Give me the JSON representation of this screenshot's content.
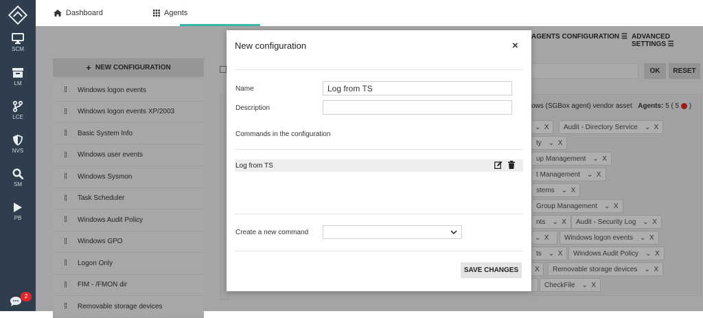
{
  "sidebar": {
    "items": [
      {
        "label": "SCM",
        "icon": "monitor-icon"
      },
      {
        "label": "LM",
        "icon": "archive-icon"
      },
      {
        "label": "LCE",
        "icon": "branch-icon"
      },
      {
        "label": "NVS",
        "icon": "shield-icon"
      },
      {
        "label": "SM",
        "icon": "search-icon"
      },
      {
        "label": "PB",
        "icon": "play-icon"
      }
    ],
    "chat_badge": "2"
  },
  "topbar": {
    "tabs": [
      {
        "label": "Dashboard",
        "icon": "home-icon"
      },
      {
        "label": "Agents",
        "icon": "grid-icon"
      }
    ]
  },
  "subheader": {
    "agents_config": "AGENTS CONFIGURATION",
    "advanced_settings": "ADVANCED SETTINGS"
  },
  "left": {
    "new_config_label": "NEW CONFIGURATION",
    "configs": [
      "Windows logon events",
      "Windows logon events XP/2003",
      "Basic System Info",
      "Windows user events",
      "Windows Sysmon",
      "Task Scheduler",
      "Windows Audit Policy",
      "Windows GPO",
      "Logon Only",
      "FIM - /FMON dir",
      "Removable storage devices"
    ]
  },
  "filter": {
    "ok": "OK",
    "reset": "RESET"
  },
  "vendor_panel": {
    "title": "ows (SGBox agent) vendor asset",
    "agents_label": "Agents:",
    "agents_count": "5 ( 5",
    "agents_close": ")",
    "tags": [
      "Audit - Directory Service",
      "ty",
      "up Management",
      "t Management",
      "stems",
      "Group Management",
      "nts",
      "Audit - Security Log",
      "Windows logon events",
      "ts",
      "Windows Audit Policy",
      "Removable storage devices",
      "CheckFile"
    ]
  },
  "modal": {
    "title": "New configuration",
    "close": "×",
    "name_label": "Name",
    "name_value": "Log from TS",
    "description_label": "Description",
    "description_value": "",
    "commands_heading": "Commands in the configuration",
    "commands": [
      {
        "label": "Log from TS"
      }
    ],
    "new_command_label": "Create a new command",
    "new_command_value": "",
    "save_label": "SAVE CHANGES"
  },
  "colors": {
    "sidebar_bg": "#2f3e4d",
    "accent": "#36b6a5",
    "overlay": "#a4a5a6",
    "badge": "#e0262b"
  }
}
